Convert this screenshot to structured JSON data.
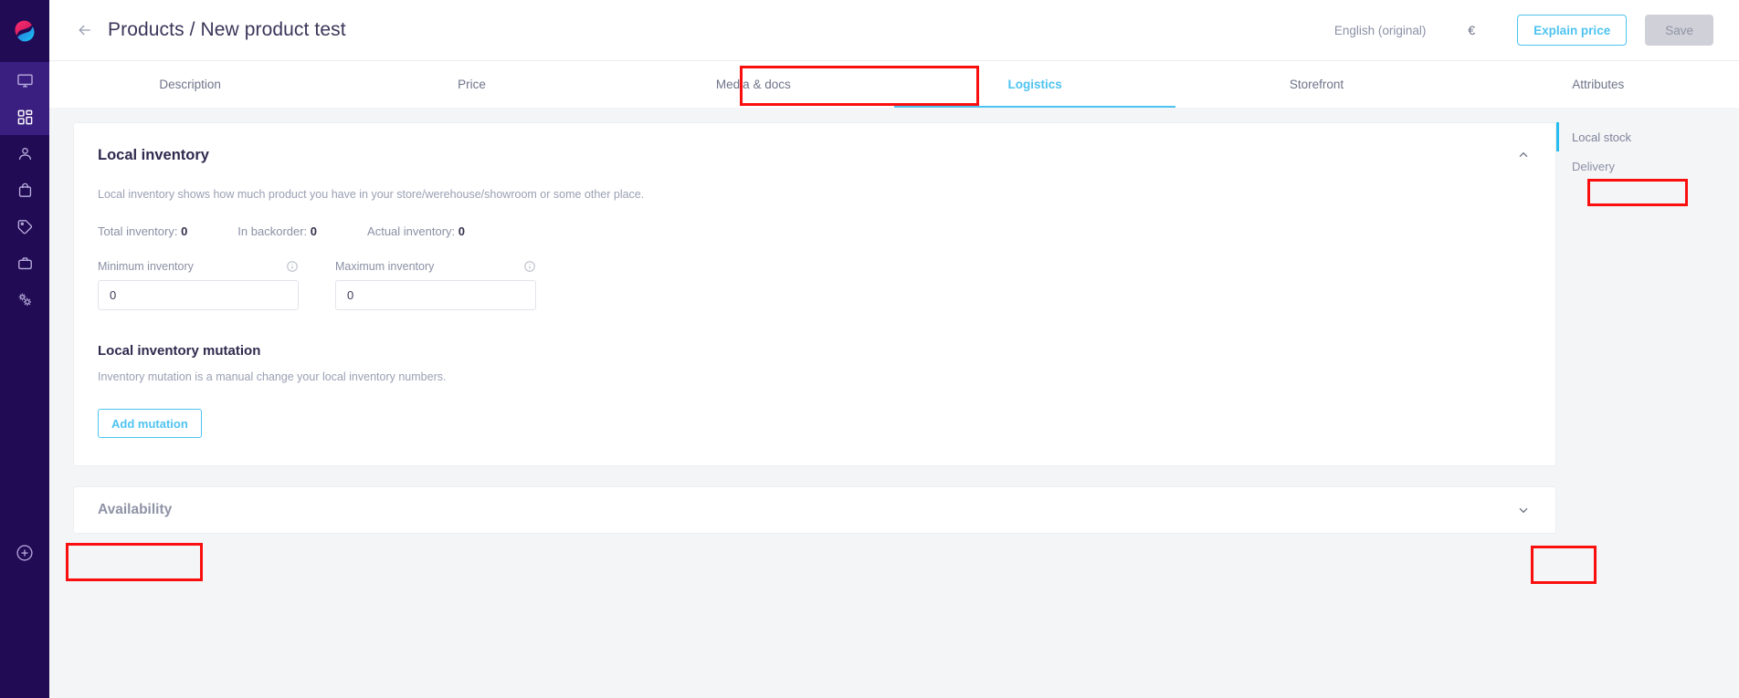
{
  "app": {
    "logo_name": "product-app-logo"
  },
  "rail": {
    "items": [
      {
        "icon": "monitor-icon",
        "name": "sidebar-item-dashboard",
        "active": false
      },
      {
        "icon": "grid-icon",
        "name": "sidebar-item-products",
        "active": true
      },
      {
        "icon": "person-icon",
        "name": "sidebar-item-customers",
        "active": false
      },
      {
        "icon": "shopping-bag-icon",
        "name": "sidebar-item-orders",
        "active": false
      },
      {
        "icon": "tag-icon",
        "name": "sidebar-item-pricing",
        "active": false
      },
      {
        "icon": "briefcase-icon",
        "name": "sidebar-item-company",
        "active": false
      },
      {
        "icon": "gears-icon",
        "name": "sidebar-item-settings",
        "active": false
      }
    ],
    "add_icon": "plus-circle-icon"
  },
  "topbar": {
    "back_icon": "back-arrow-icon",
    "title": "Products / New product test",
    "language": "English (original)",
    "currency": "€",
    "explain_price_label": "Explain price",
    "save_label": "Save"
  },
  "tabs": [
    {
      "label": "Description",
      "active": false
    },
    {
      "label": "Price",
      "active": false
    },
    {
      "label": "Media & docs",
      "active": false
    },
    {
      "label": "Logistics",
      "active": true
    },
    {
      "label": "Storefront",
      "active": false
    },
    {
      "label": "Attributes",
      "active": false
    }
  ],
  "local_inventory": {
    "title": "Local inventory",
    "collapse_icon": "chevron-up-icon",
    "description": "Local inventory shows how much product you have in your store/werehouse/showroom or some other place.",
    "stats": [
      {
        "label": "Total inventory:",
        "value": "0"
      },
      {
        "label": "In backorder:",
        "value": "0"
      },
      {
        "label": "Actual inventory:",
        "value": "0"
      }
    ],
    "fields": [
      {
        "label": "Minimum inventory",
        "value": "0",
        "info_icon": "info-icon"
      },
      {
        "label": "Maximum inventory",
        "value": "0",
        "info_icon": "info-icon"
      }
    ],
    "mutation_title": "Local inventory mutation",
    "mutation_text": "Inventory mutation is a manual change your local inventory numbers.",
    "add_mutation_label": "Add mutation"
  },
  "availability": {
    "title": "Availability",
    "expand_icon": "chevron-down-icon"
  },
  "subnav": {
    "items": [
      {
        "label": "Local stock",
        "active": true
      },
      {
        "label": "Delivery",
        "active": false
      }
    ]
  },
  "colors": {
    "accent": "#4ec3f0",
    "rail_bg": "#200b54",
    "annotation": "#fa0f0f",
    "page_bg": "#f4f5f7"
  }
}
